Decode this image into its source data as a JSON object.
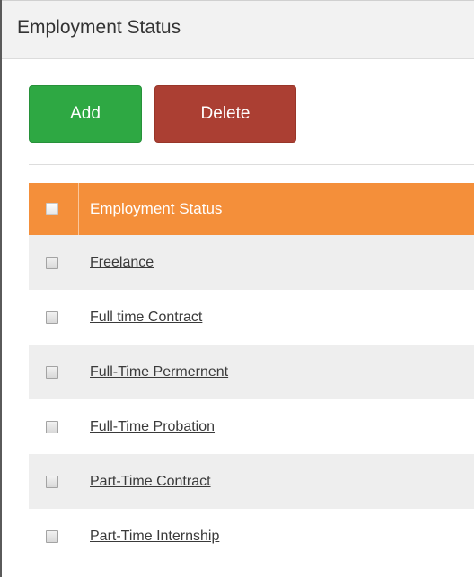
{
  "header": {
    "title": "Employment Status"
  },
  "toolbar": {
    "add_label": "Add",
    "delete_label": "Delete"
  },
  "table": {
    "column_header": "Employment Status",
    "rows": [
      {
        "label": "Freelance"
      },
      {
        "label": "Full time Contract"
      },
      {
        "label": "Full-Time Permernent"
      },
      {
        "label": "Full-Time Probation"
      },
      {
        "label": "Part-Time Contract"
      },
      {
        "label": "Part-Time Internship"
      }
    ]
  },
  "colors": {
    "header_bg": "#f2f2f2",
    "add_button": "#2ea843",
    "delete_button": "#ab3f33",
    "table_header": "#f48f3a",
    "row_alt": "#eeeeee"
  },
  "icons": {
    "checkbox": "checkbox-icon"
  }
}
